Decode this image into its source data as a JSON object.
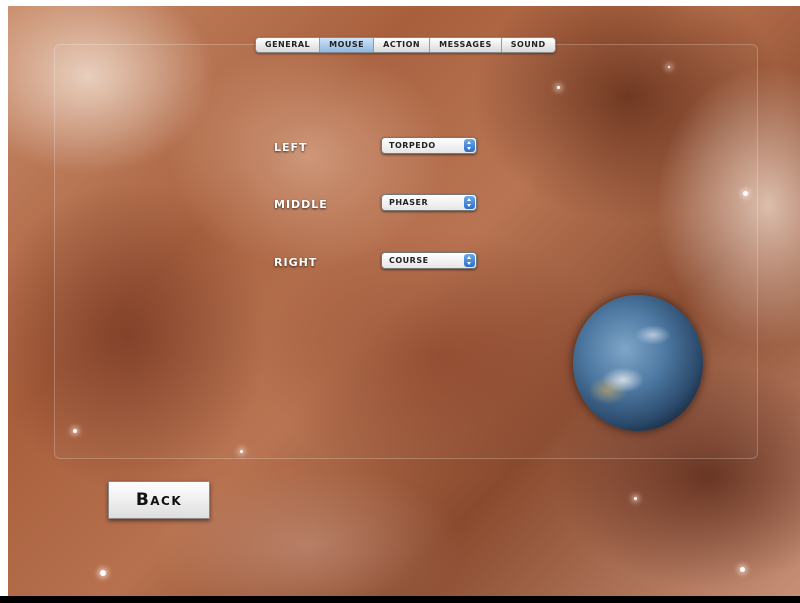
{
  "tabs": [
    {
      "label": "General",
      "active": false
    },
    {
      "label": "Mouse",
      "active": true
    },
    {
      "label": "Action",
      "active": false
    },
    {
      "label": "Messages",
      "active": false
    },
    {
      "label": "Sound",
      "active": false
    }
  ],
  "mouse_settings": [
    {
      "label": "Left",
      "value": "Torpedo"
    },
    {
      "label": "Middle",
      "value": "Phaser"
    },
    {
      "label": "Right",
      "value": "Course"
    }
  ],
  "back_button": {
    "label": "Back"
  },
  "colors": {
    "active_tab": "#8fb8e0",
    "select_arrow": "#2c6fc7"
  }
}
